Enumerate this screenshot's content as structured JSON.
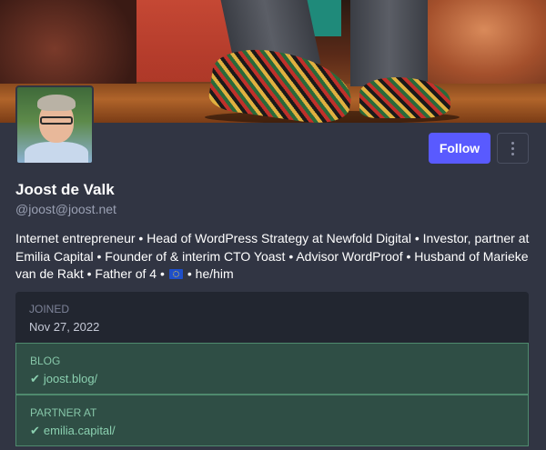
{
  "profile": {
    "name": "Joost de Valk",
    "handle": "@joost@joost.net",
    "bio_part1": "Internet entrepreneur • Head of WordPress Strategy at Newfold Digital • Investor, partner at Emilia Capital • Founder of & interim CTO Yoast • Advisor WordProof • Husband of Marieke van de Rakt • Father of 4 •",
    "bio_part2": "• he/him",
    "bio_emoji_name": "eu-flag-icon"
  },
  "actions": {
    "follow_label": "Follow",
    "more_icon": "vertical-ellipsis-icon",
    "accent_color": "#595aff"
  },
  "fields": {
    "joined": {
      "label": "JOINED",
      "value": "Nov 27, 2022"
    },
    "blog": {
      "label": "BLOG",
      "value": "joost.blog/",
      "verified": true
    },
    "partner": {
      "label": "PARTNER AT",
      "value": "emilia.capital/",
      "verified": true
    }
  },
  "colors": {
    "background": "#313543",
    "verified_bg": "#2f4e45",
    "verified_text": "#8bd0b0"
  }
}
